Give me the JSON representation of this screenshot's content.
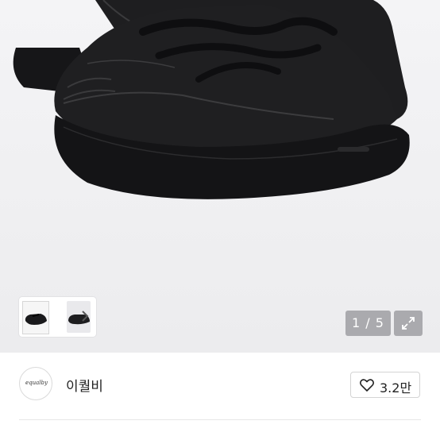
{
  "gallery": {
    "counter": "1 / 5",
    "thumbnail_next_icon": "chevron-right-icon",
    "expand_icon": "expand-icon",
    "thumbnails": [
      "shoe-pair-thumb",
      "shoe-side-thumb"
    ]
  },
  "seller": {
    "logo_text": "equalby",
    "name": "이퀄비"
  },
  "like": {
    "icon": "heart-outline-icon",
    "count": "3.2만"
  },
  "colors": {
    "product": "#1c1c1e",
    "counter_bg": "#aaaaae",
    "background": "#f0f0f2"
  }
}
